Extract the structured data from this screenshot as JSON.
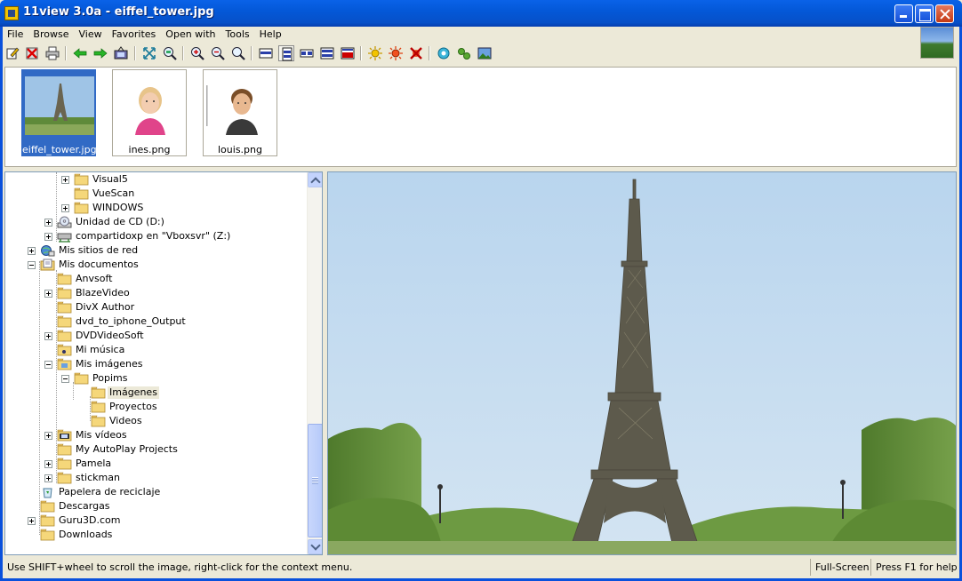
{
  "window": {
    "title": "11view 3.0a - eiffel_tower.jpg"
  },
  "menu": [
    "File",
    "Browse",
    "View",
    "Favorites",
    "Open with",
    "Tools",
    "Help"
  ],
  "toolbar_icons": [
    "edit-icon",
    "delete-icon",
    "print-icon",
    "back-arrow-icon",
    "forward-arrow-icon",
    "slideshow-icon",
    "fit-screen-icon",
    "zoom-fit-icon",
    "zoom-in-icon",
    "zoom-out-icon",
    "zoom-icon",
    "layout-thumbs-top-icon",
    "layout-thumbs-left-icon",
    "layout-thumbs-bottom-icon",
    "layout-image-only-icon",
    "layout-full-icon",
    "brightness-icon",
    "color-icon",
    "remove-effects-icon",
    "settings-icon",
    "plugins-icon",
    "wallpaper-icon"
  ],
  "thumbnails": [
    {
      "name": "eiffel_tower.jpg",
      "selected": true
    },
    {
      "name": "ines.png",
      "selected": false
    },
    {
      "name": "louis.png",
      "selected": false
    }
  ],
  "tree": [
    {
      "label": "Visual5",
      "expander": "plus",
      "icon": "folder"
    },
    {
      "label": "VueScan",
      "expander": "none",
      "icon": "folder"
    },
    {
      "label": "WINDOWS",
      "expander": "plus",
      "icon": "folder"
    },
    {
      "label": "Unidad de CD (D:)",
      "expander": "plus",
      "icon": "cd-drive"
    },
    {
      "label": "compartidoxp en \"Vboxsvr\" (Z:)",
      "expander": "plus",
      "icon": "network-drive"
    },
    {
      "label": "Mis sitios de red",
      "expander": "plus",
      "icon": "network-places"
    },
    {
      "label": "Mis documentos",
      "expander": "minus",
      "icon": "my-documents"
    },
    {
      "label": "Anvsoft",
      "expander": "none",
      "icon": "folder"
    },
    {
      "label": "BlazeVideo",
      "expander": "plus",
      "icon": "folder"
    },
    {
      "label": "DivX Author",
      "expander": "none",
      "icon": "folder"
    },
    {
      "label": "dvd_to_iphone_Output",
      "expander": "none",
      "icon": "folder"
    },
    {
      "label": "DVDVideoSoft",
      "expander": "plus",
      "icon": "folder"
    },
    {
      "label": "Mi música",
      "expander": "none",
      "icon": "music-folder"
    },
    {
      "label": "Mis imágenes",
      "expander": "minus",
      "icon": "pictures-folder"
    },
    {
      "label": "Popims",
      "expander": "minus",
      "icon": "folder"
    },
    {
      "label": "Imágenes",
      "expander": "none",
      "icon": "folder",
      "selected": true
    },
    {
      "label": "Proyectos",
      "expander": "none",
      "icon": "folder"
    },
    {
      "label": "Videos",
      "expander": "none",
      "icon": "folder"
    },
    {
      "label": "Mis vídeos",
      "expander": "plus",
      "icon": "videos-folder"
    },
    {
      "label": "My AutoPlay Projects",
      "expander": "none",
      "icon": "folder"
    },
    {
      "label": "Pamela",
      "expander": "plus",
      "icon": "folder"
    },
    {
      "label": "stickman",
      "expander": "plus",
      "icon": "folder"
    },
    {
      "label": "Papelera de reciclaje",
      "expander": "none",
      "icon": "recycle-bin"
    },
    {
      "label": "Descargas",
      "expander": "none",
      "icon": "folder"
    },
    {
      "label": "Guru3D.com",
      "expander": "plus",
      "icon": "folder"
    },
    {
      "label": "Downloads",
      "expander": "none",
      "icon": "folder"
    }
  ],
  "status": {
    "hint": "Use SHIFT+wheel to scroll the image, right-click for the context menu.",
    "mode": "Full-Screen",
    "help": "Press F1 for help"
  },
  "colors": {
    "titlebar": "#0458D8",
    "selection": "#316AC5",
    "folder": "#F5D77A"
  }
}
